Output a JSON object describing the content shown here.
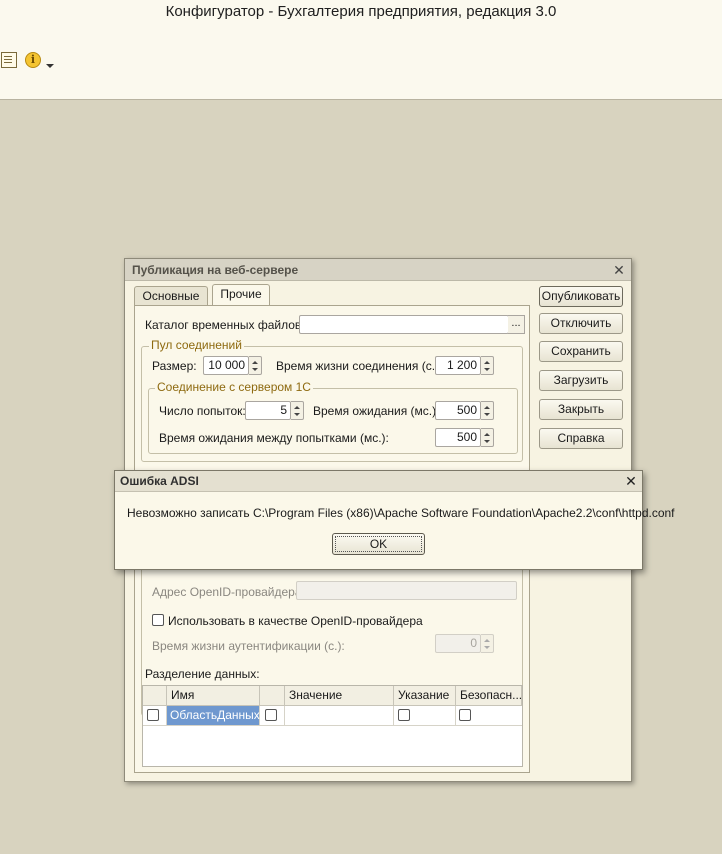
{
  "app": {
    "title": "Конфигуратор - Бухгалтерия предприятия, редакция 3.0",
    "toolbar_icons": [
      "document-icon",
      "info-icon",
      "dropdown-caret-icon"
    ],
    "info_glyph": "i"
  },
  "publish_dialog": {
    "title": "Публикация на веб-сервере",
    "close_glyph": "✕",
    "tabs": [
      {
        "label": "Основные",
        "active": false
      },
      {
        "label": "Прочие",
        "active": true
      }
    ],
    "temp_dir": {
      "label": "Каталог временных файлов:",
      "value": "",
      "browse": "..."
    },
    "pool": {
      "title": "Пул соединений",
      "size_label": "Размер:",
      "size_value": "10 000",
      "lifetime_label": "Время жизни соединения (с.):",
      "lifetime_value": "1 200"
    },
    "server_conn": {
      "title": "Соединение с сервером 1С",
      "attempts_label": "Число попыток:",
      "attempts_value": "5",
      "wait_label": "Время ожидания (мс.):",
      "wait_value": "500",
      "between_label": "Время ожидания между попытками (мс.):",
      "between_value": "500"
    },
    "openid": {
      "provider_address_label": "Адрес OpenID-провайдера:",
      "provider_address_value": "",
      "use_as_provider_label": "Использовать в качестве OpenID-провайдера",
      "use_as_provider_checked": false,
      "auth_lifetime_label": "Время жизни аутентификации (с.):",
      "auth_lifetime_value": "0"
    },
    "data_separation": {
      "label": "Разделение данных:",
      "columns": [
        "Имя",
        "Значение",
        "Указание",
        "Безопасн..."
      ],
      "rows": [
        {
          "checked": false,
          "name": "ОбластьДанных",
          "value_checked": false,
          "value": "",
          "indication_checked": false,
          "safe_checked": false
        }
      ]
    },
    "buttons": {
      "publish": "Опубликовать",
      "disable": "Отключить",
      "save": "Сохранить",
      "load": "Загрузить",
      "close": "Закрыть",
      "help": "Справка"
    }
  },
  "error_dialog": {
    "title": "Ошибка ADSI",
    "close_glyph": "✕",
    "message": "Невозможно записать C:\\Program Files (x86)\\Apache Software Foundation\\Apache2.2\\conf\\httpd.conf",
    "ok": "OK"
  }
}
